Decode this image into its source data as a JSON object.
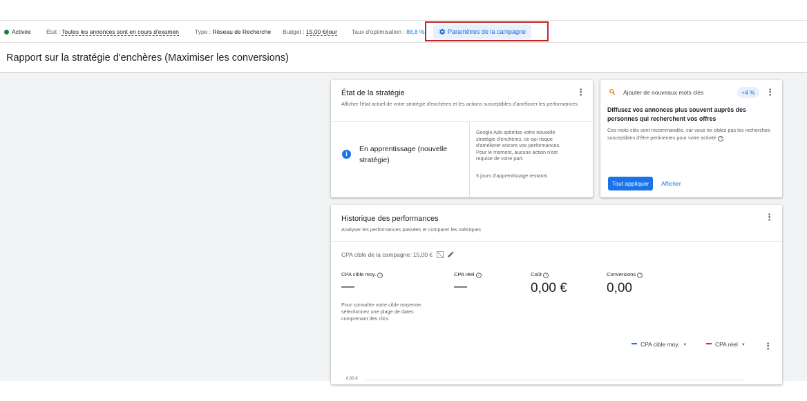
{
  "status_bar": {
    "status": "Activée",
    "state_label": "État :",
    "state_value": "Toutes les annonces sont en cours d'examen",
    "type_label": "Type :",
    "type_value": "Réseau de Recherche",
    "budget_label": "Budget :",
    "budget_value": "15,00 €/jour",
    "optim_label": "Taux d'optimisation :",
    "optim_value": "88,8 %",
    "params_button": "Paramètres de la campagne",
    "status_color": "#188038",
    "highlight_color": "#c5221f"
  },
  "page_title": "Rapport sur la stratégie d'enchères (Maximiser les conversions)",
  "strategy_card": {
    "title": "État de la stratégie",
    "subtitle": "Afficher l'état actuel de votre stratégie d'enchères et les actions susceptibles d'améliorer les performances",
    "status": "En apprentissage (nouvelle stratégie)",
    "description": "Google Ads optimise votre nouvelle stratégie d'enchères, ce qui risque d'améliorer encore vos performances. Pour le moment, aucune action n'est requise de votre part.",
    "remaining": "5 jours d'apprentissage restants"
  },
  "keywords_card": {
    "title": "Ajouter de nouveaux mots clés",
    "badge": "+4 %",
    "headline": "Diffusez vos annonces plus souvent auprès des personnes qui recherchent vos offres",
    "description": "Ces mots clés sont recommandés, car vous ne ciblez pas les recherches susceptibles d'être pertinentes pour votre activité",
    "apply_button": "Tout appliquer",
    "show_button": "Afficher"
  },
  "performance_card": {
    "title": "Historique des performances",
    "subtitle": "Analyser les performances passées et comparer les métriques",
    "target_cpa": "CPA cible de la campagne: 15,00 €",
    "metrics": [
      {
        "label": "CPA cible moy.",
        "value": "—",
        "note": "Pour connaître votre cible moyenne, sélectionnez une plage de dates comprenant des clics"
      },
      {
        "label": "CPA réel",
        "value": "—"
      },
      {
        "label": "Coût",
        "value": "0,00 €"
      },
      {
        "label": "Conversions",
        "value": "0,00"
      }
    ],
    "legend": [
      {
        "label": "CPA cible moy.",
        "color": "#1a73e8"
      },
      {
        "label": "CPA réel",
        "color": "#d93025"
      }
    ],
    "axis_tick": "0,00 €"
  }
}
